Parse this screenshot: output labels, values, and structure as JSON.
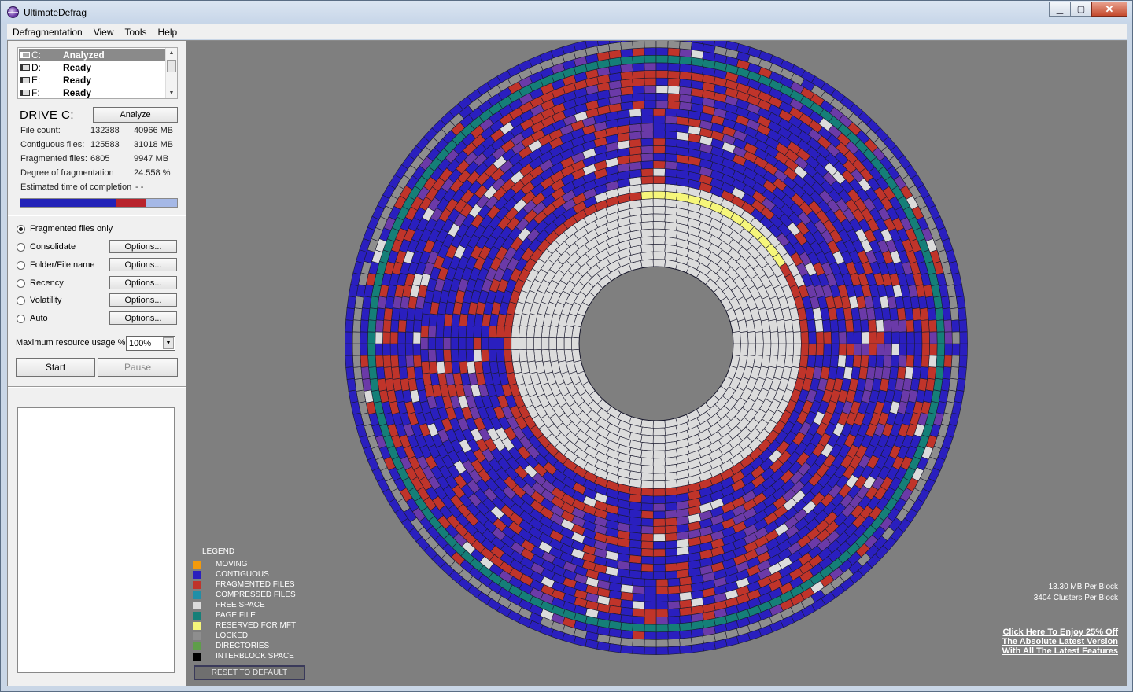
{
  "window": {
    "title": "UltimateDefrag",
    "minimize": "▁",
    "maximize": "▢",
    "close": "✕"
  },
  "menu": [
    "Defragmentation",
    "View",
    "Tools",
    "Help"
  ],
  "drives": [
    {
      "letter": "C:",
      "status": "Analyzed",
      "selected": true
    },
    {
      "letter": "D:",
      "status": "Ready",
      "selected": false
    },
    {
      "letter": "E:",
      "status": "Ready",
      "selected": false
    },
    {
      "letter": "F:",
      "status": "Ready",
      "selected": false
    }
  ],
  "drive_panel": {
    "title": "DRIVE C:",
    "analyze_label": "Analyze",
    "stats": [
      {
        "label": "File count:",
        "value": "132388",
        "size": "40966 MB"
      },
      {
        "label": "Contiguous files:",
        "value": "125583",
        "size": "31018 MB"
      },
      {
        "label": "Fragmented files:",
        "value": "6805",
        "size": "9947 MB"
      },
      {
        "label": "Degree of fragmentation",
        "value": "",
        "size": "24.558 %"
      }
    ],
    "eta_label": "Estimated time of completion",
    "eta_value": "- -",
    "usage_bar": [
      {
        "fraction": 0.61,
        "color": "#2222b8"
      },
      {
        "fraction": 0.19,
        "color": "#b8232c"
      },
      {
        "fraction": 0.2,
        "color": "#a5b8e6"
      }
    ]
  },
  "modes": [
    {
      "label": "Fragmented files only",
      "selected": true,
      "has_options": false
    },
    {
      "label": "Consolidate",
      "selected": false,
      "has_options": true
    },
    {
      "label": "Folder/File name",
      "selected": false,
      "has_options": true
    },
    {
      "label": "Recency",
      "selected": false,
      "has_options": true
    },
    {
      "label": "Volatility",
      "selected": false,
      "has_options": true
    },
    {
      "label": "Auto",
      "selected": false,
      "has_options": true
    }
  ],
  "options_label": "Options...",
  "resource": {
    "label": "Maximum resource usage %",
    "value": "100%"
  },
  "controls": {
    "start_label": "Start",
    "pause_label": "Pause"
  },
  "legend": {
    "title": "LEGEND",
    "items": [
      {
        "label": "MOVING",
        "color": "#f29a0c"
      },
      {
        "label": "CONTIGUOUS",
        "color": "#2a1fbf"
      },
      {
        "label": "FRAGMENTED FILES",
        "color": "#c0342a"
      },
      {
        "label": "COMPRESSED FILES",
        "color": "#1f8fa8"
      },
      {
        "label": "FREE SPACE",
        "color": "#dcdcdc"
      },
      {
        "label": "PAGE FILE",
        "color": "#157f78"
      },
      {
        "label": "RESERVED FOR MFT",
        "color": "#f6f67a"
      },
      {
        "label": "LOCKED",
        "color": "#8e8e8e"
      },
      {
        "label": "DIRECTORIES",
        "color": "#5f9e4a"
      },
      {
        "label": "INTERBLOCK SPACE",
        "color": "#000000"
      }
    ],
    "reset_label": "RESET TO DEFAULT"
  },
  "block_info": {
    "mb_per_block": "13.30 MB Per Block",
    "clusters_per_block": "3404 Clusters Per Block"
  },
  "promo": [
    "Click Here To Enjoy 25% Off",
    "The Absolute Latest Version",
    "With All The Latest Features"
  ],
  "disk_map": {
    "palette": {
      "contiguous": "#2a1fbf",
      "fragmented": "#c0342a",
      "free": "#dcdcdc",
      "page": "#157f78",
      "locked": "#8e8e8e",
      "mft": "#f6f67a",
      "purple": "#6b3aa8",
      "grid": "#1a1a2e"
    }
  }
}
